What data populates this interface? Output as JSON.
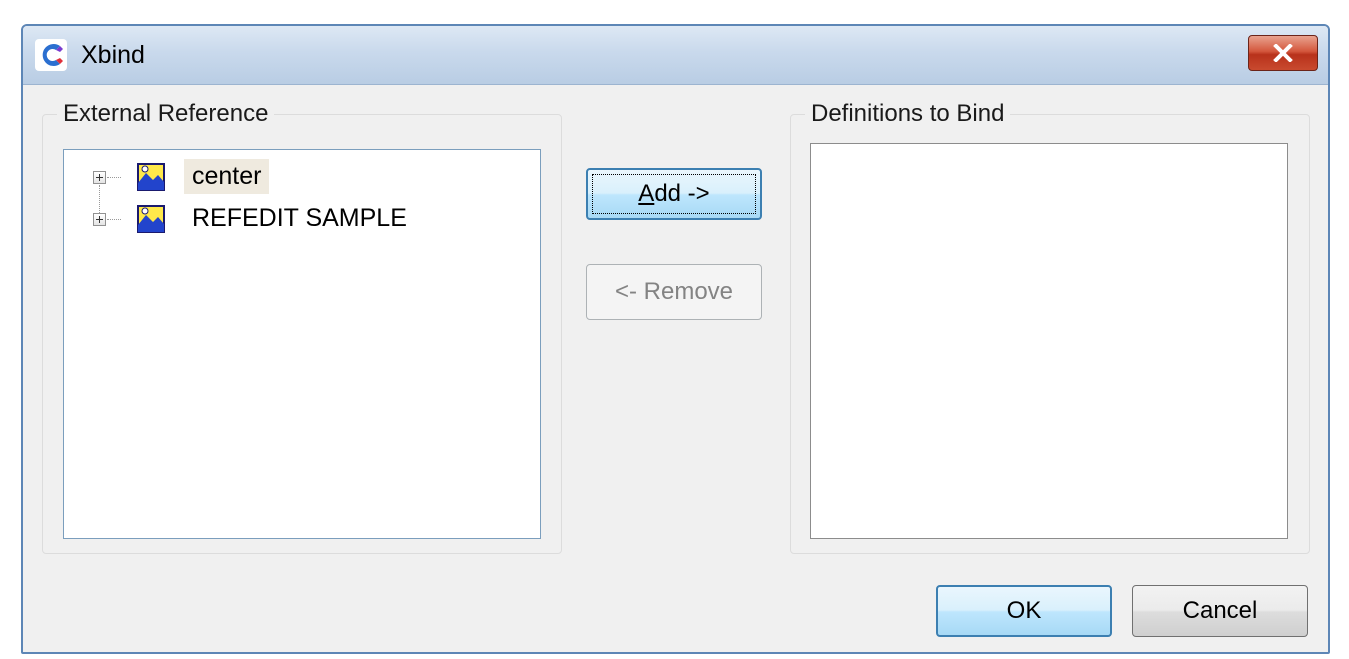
{
  "window": {
    "title": "Xbind",
    "icon": "app-logo-icon",
    "close_icon": "close-icon"
  },
  "external_reference": {
    "label": "External Reference",
    "items": [
      {
        "label": "center",
        "icon": "xref-drawing-icon",
        "selected": true
      },
      {
        "label": "REFEDIT SAMPLE",
        "icon": "xref-drawing-icon",
        "selected": false
      }
    ]
  },
  "definitions": {
    "label": "Definitions to Bind",
    "items": []
  },
  "buttons": {
    "add": {
      "mnemonic": "A",
      "rest": "dd ->"
    },
    "remove": "<- Remove",
    "ok": "OK",
    "cancel": "Cancel"
  },
  "colors": {
    "accent": "#3c7fb1",
    "close_button": "#c94a2f",
    "title_gradient": "#c9d9ec"
  }
}
